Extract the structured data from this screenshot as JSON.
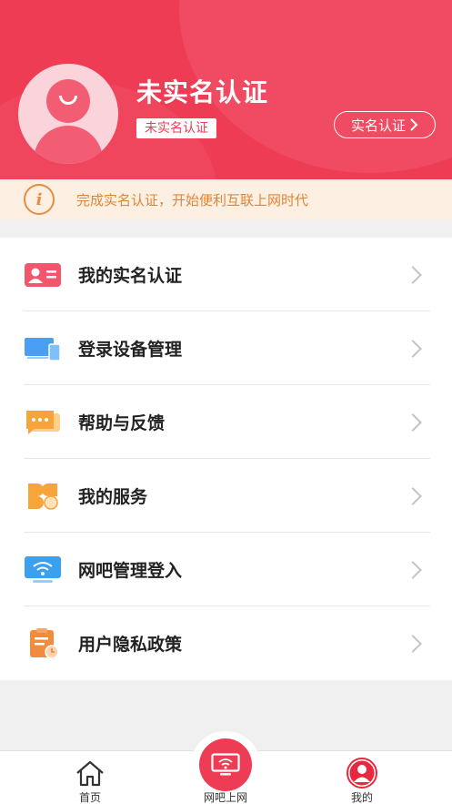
{
  "profile": {
    "name": "未实名认证",
    "badge": "未实名认证",
    "verify_button": "实名认证"
  },
  "notice": {
    "icon": "info-icon",
    "text": "完成实名认证，开始便利互联上网时代"
  },
  "menu": {
    "items": [
      {
        "label": "我的实名认证",
        "icon": "id-card-icon"
      },
      {
        "label": "登录设备管理",
        "icon": "devices-icon"
      },
      {
        "label": "帮助与反馈",
        "icon": "chat-bubble-icon"
      },
      {
        "label": "我的服务",
        "icon": "clover-grid-icon"
      },
      {
        "label": "网吧管理登入",
        "icon": "wifi-monitor-icon"
      },
      {
        "label": "用户隐私政策",
        "icon": "clipboard-clock-icon"
      }
    ]
  },
  "tabbar": {
    "home": "首页",
    "internet": "网吧上网",
    "mine": "我的"
  },
  "colors": {
    "brand": "#ef3c55",
    "notice_text": "#e08536",
    "notice_bg": "#fdf0e2"
  }
}
